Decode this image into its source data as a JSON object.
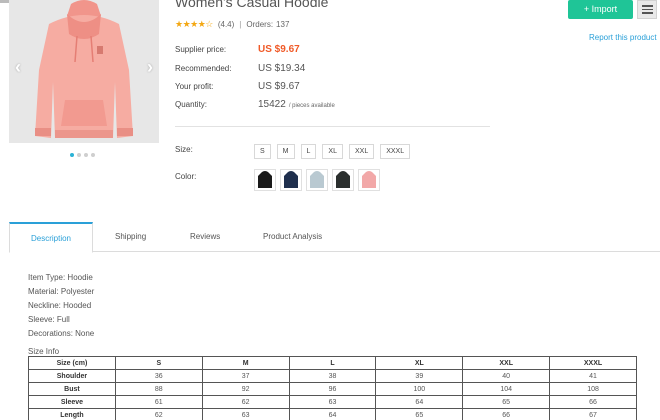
{
  "product": {
    "title": "Women's Casual Hoodie",
    "rating": "(4.4)",
    "orders_label": "Orders:",
    "orders": "137",
    "supplier_price_label": "Supplier price:",
    "supplier_price": "US $9.67",
    "recommended_label": "Recommended:",
    "recommended": "US $19.34",
    "profit_label": "Your profit:",
    "profit": "US $9.67",
    "quantity_label": "Quantity:",
    "quantity": "15422",
    "quantity_unit": "/ pieces available",
    "size_label": "Size:",
    "sizes": [
      "S",
      "M",
      "L",
      "XL",
      "XXL",
      "XXXL"
    ],
    "color_label": "Color:",
    "colors": [
      "#1a1a1a",
      "#1f2f4d",
      "#b9c9d1",
      "#2b2f2e",
      "#f2a8a8"
    ],
    "rating_value": 4.4
  },
  "actions": {
    "import_label": "+ Import",
    "report_label": "Report this product"
  },
  "tabs": [
    "Description",
    "Shipping",
    "Reviews",
    "Product Analysis"
  ],
  "description": [
    "Item Type: Hoodie",
    "Material: Polyester",
    "Neckline: Hooded",
    "Sleeve: Full",
    "Decorations: None"
  ],
  "size_info_label": "Size Info",
  "size_table": {
    "headers": [
      "Size (cm)",
      "S",
      "M",
      "L",
      "XL",
      "XXL",
      "XXXL"
    ],
    "rows": [
      [
        "Shoulder",
        "36",
        "37",
        "38",
        "39",
        "40",
        "41"
      ],
      [
        "Bust",
        "88",
        "92",
        "96",
        "100",
        "104",
        "108"
      ],
      [
        "Sleeve",
        "61",
        "62",
        "63",
        "64",
        "65",
        "66"
      ],
      [
        "Length",
        "62",
        "63",
        "64",
        "65",
        "66",
        "67"
      ]
    ]
  },
  "gallery": {
    "dot_count": 4,
    "active_dot": 0,
    "main_color": "#f4a49a"
  }
}
